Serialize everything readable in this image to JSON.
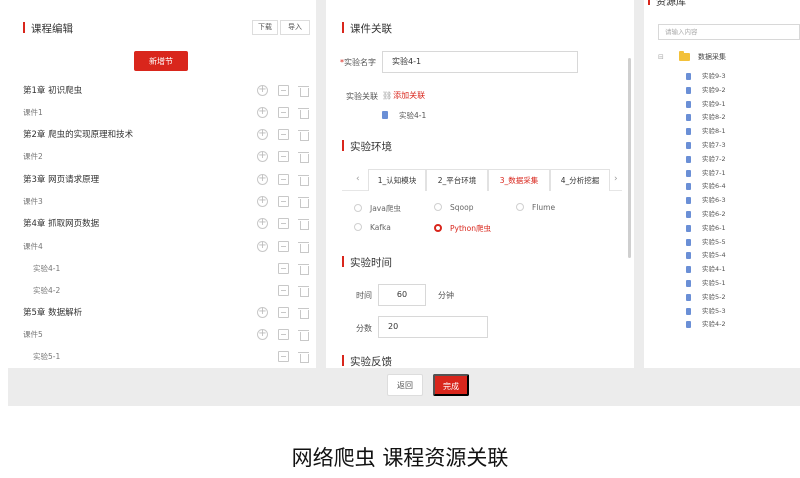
{
  "left_panel": {
    "title": "课程编辑",
    "download_label": "下载",
    "import_label": "导入",
    "new_section_label": "新增节",
    "tree": [
      {
        "label": "第1章 初识爬虫",
        "level": 0
      },
      {
        "label": "课件1",
        "level": 1
      },
      {
        "label": "第2章 爬虫的实现原理和技术",
        "level": 0
      },
      {
        "label": "课件2",
        "level": 1
      },
      {
        "label": "第3章 网页请求原理",
        "level": 0
      },
      {
        "label": "课件3",
        "level": 1
      },
      {
        "label": "第4章 抓取网页数据",
        "level": 0
      },
      {
        "label": "课件4",
        "level": 1
      },
      {
        "label": "实验4-1",
        "level": 2
      },
      {
        "label": "实验4-2",
        "level": 2
      },
      {
        "label": "第5章 数据解析",
        "level": 0
      },
      {
        "label": "课件5",
        "level": 1
      },
      {
        "label": "实验5-1",
        "level": 2
      }
    ]
  },
  "middle_panel": {
    "title": "课件关联",
    "name_label": "实验名字",
    "required_mark": "*",
    "name_value": "实验4-1",
    "relation_label": "实验关联",
    "add_relation_link": "添加关联",
    "related_item": "实验4-1",
    "env_title": "实验环境",
    "tabs": [
      "1_认知模块",
      "2_平台环境",
      "3_数据采集",
      "4_分析挖掘"
    ],
    "active_tab": 2,
    "options": [
      "Java爬虫",
      "Sqoop",
      "Flume",
      "Kafka",
      "Python爬虫"
    ],
    "selected_option": "Python爬虫",
    "time_title": "实验时间",
    "time_label": "时间",
    "time_value": "60",
    "time_unit": "分钟",
    "score_label": "分数",
    "score_value": "20",
    "feedback_title": "实验反馈"
  },
  "right_panel": {
    "title": "资源库",
    "search_placeholder": "请输入内容",
    "folder": "数据采集",
    "items": [
      "实验9-3",
      "实验9-2",
      "实验9-1",
      "实验8-2",
      "实验8-1",
      "实验7-3",
      "实验7-2",
      "实验7-1",
      "实验6-4",
      "实验6-3",
      "实验6-2",
      "实验6-1",
      "实验5-5",
      "实验5-4",
      "实验4-1",
      "实验5-1",
      "实验5-2",
      "实验5-3",
      "实验4-2"
    ]
  },
  "footer": {
    "back_label": "返回",
    "done_label": "完成"
  },
  "caption": "网络爬虫 课程资源关联",
  "colors": {
    "accent": "#d9261c",
    "file_icon": "#6a8fd6",
    "folder_icon": "#f3c13a",
    "background": "#ececec"
  }
}
